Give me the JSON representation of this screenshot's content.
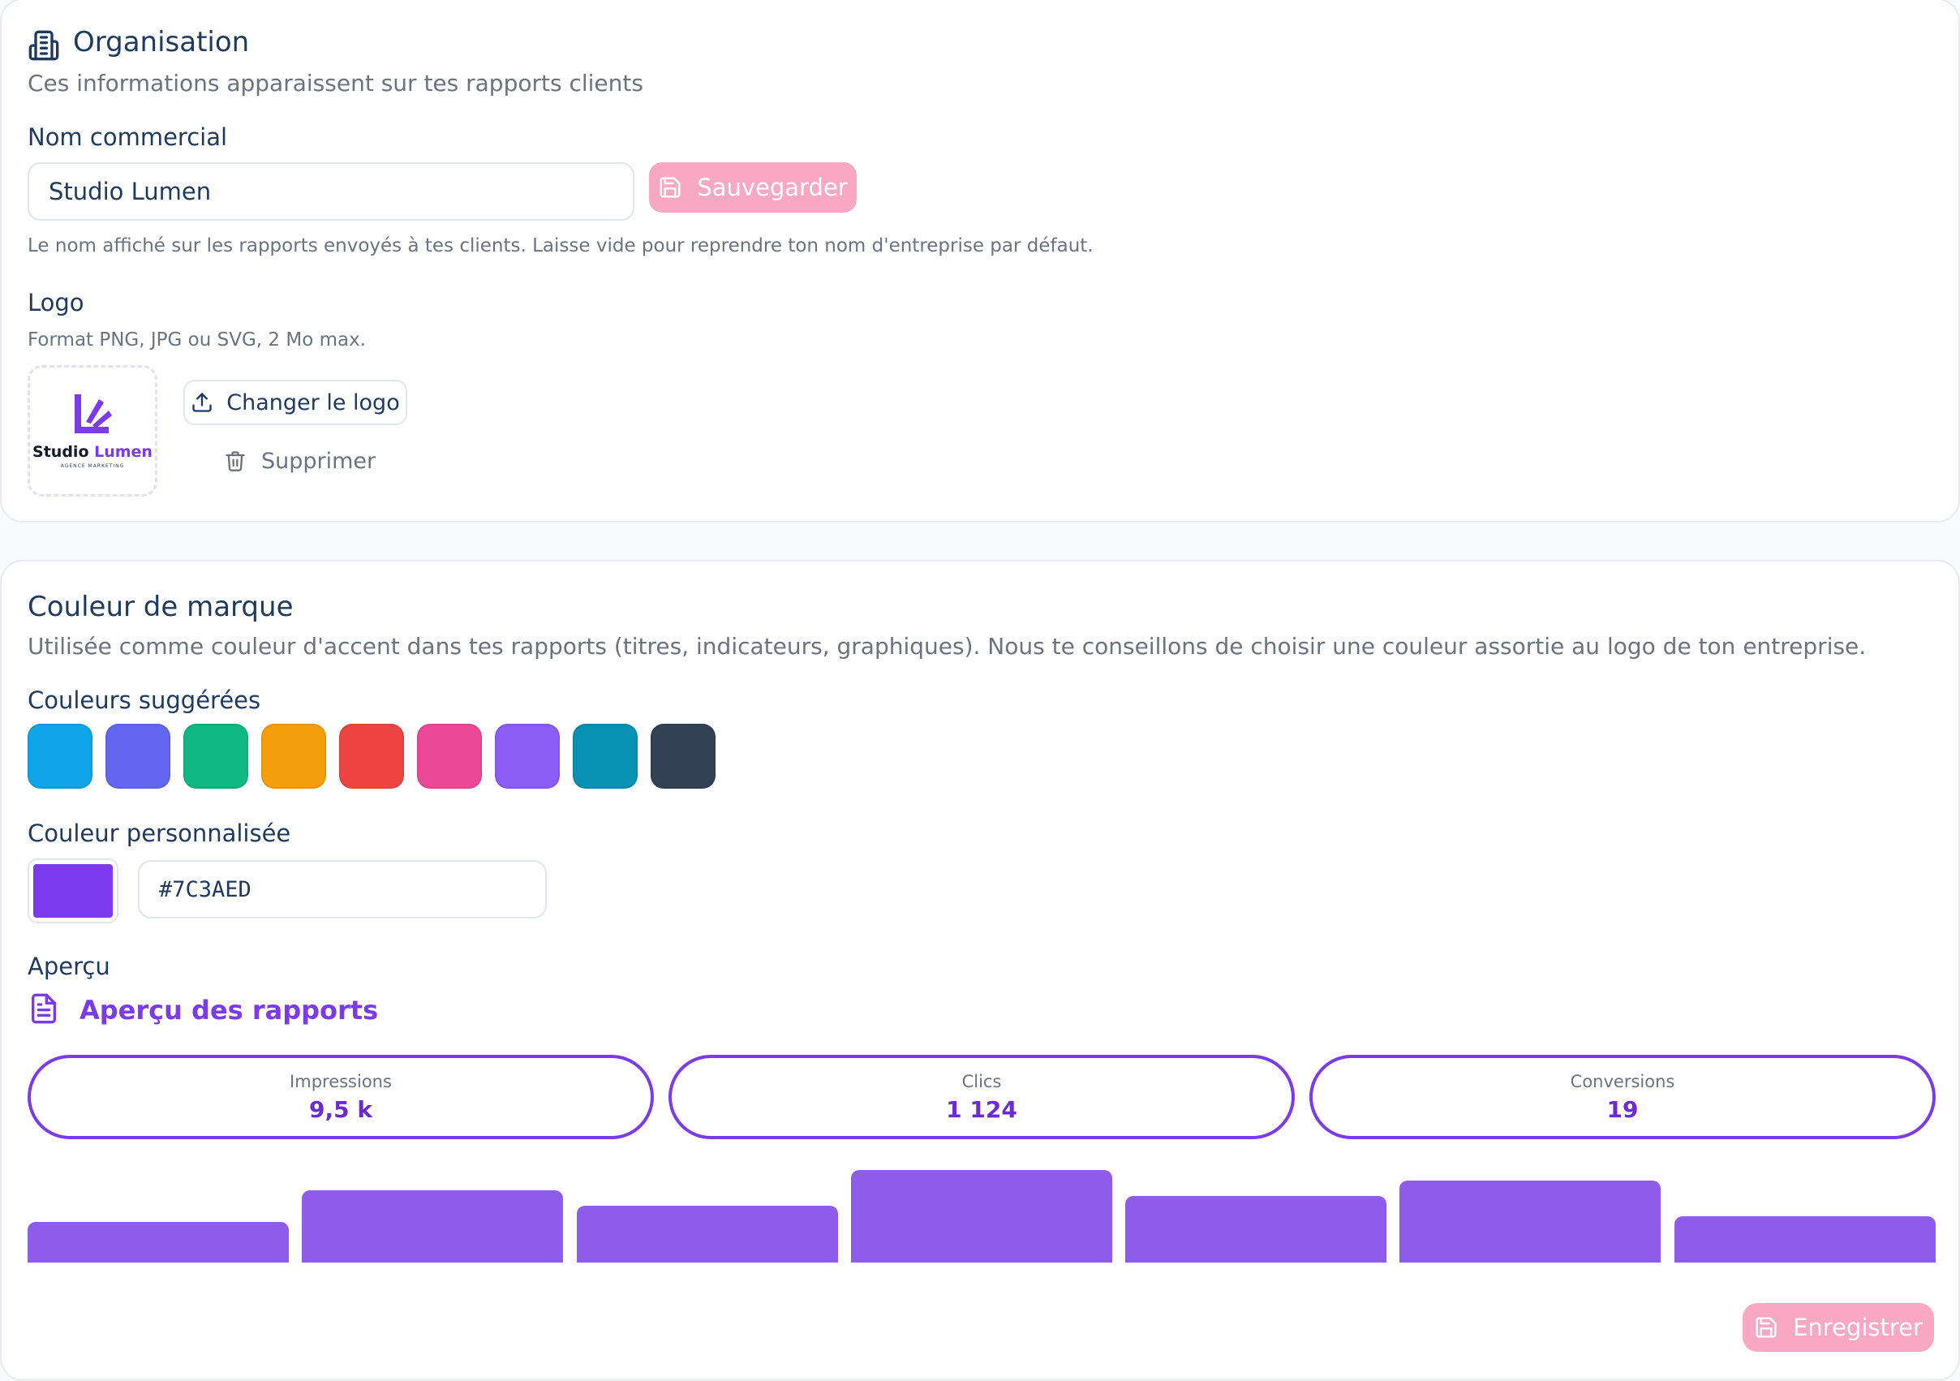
{
  "organisation": {
    "title": "Organisation",
    "subtitle": "Ces informations apparaissent sur tes rapports clients",
    "name_label": "Nom commercial",
    "name_value": "Studio Lumen",
    "save_label": "Sauvegarder",
    "name_hint": "Le nom affiché sur les rapports envoyés à tes clients. Laisse vide pour reprendre ton nom d'entreprise par défaut.",
    "logo_label": "Logo",
    "logo_hint": "Format PNG, JPG ou SVG, 2 Mo max.",
    "logo_name_a": "Studio ",
    "logo_name_b": "Lumen",
    "logo_tagline": "AGENCE MARKETING",
    "change_logo_label": "Changer le logo",
    "delete_label": "Supprimer"
  },
  "brand": {
    "title": "Couleur de marque",
    "subtitle": "Utilisée comme couleur d'accent dans tes rapports (titres, indicateurs, graphiques). Nous te conseillons de choisir une couleur assortie au logo de ton entreprise.",
    "suggested_label": "Couleurs suggérées",
    "swatches": [
      "#0ea5e9",
      "#6366f1",
      "#10b981",
      "#f59e0b",
      "#ef4444",
      "#ec4899",
      "#8b5cf6",
      "#0891b2",
      "#334155"
    ],
    "custom_label": "Couleur personnalisée",
    "custom_value": "#7C3AED",
    "preview_label": "Aperçu",
    "preview_title": "Aperçu des rapports",
    "stats": [
      {
        "label": "Impressions",
        "value": "9,5 k"
      },
      {
        "label": "Clics",
        "value": "1 124"
      },
      {
        "label": "Conversions",
        "value": "19"
      }
    ],
    "register_label": "Enregistrer"
  },
  "chart_data": {
    "type": "bar",
    "values": [
      0.44,
      0.78,
      0.61,
      1.0,
      0.72,
      0.89,
      0.5
    ]
  },
  "colors": {
    "accent": "#7C3AED",
    "bar": "#8e5bea",
    "pink_button": "#f9a8c4",
    "heading": "#1e3a5f"
  }
}
